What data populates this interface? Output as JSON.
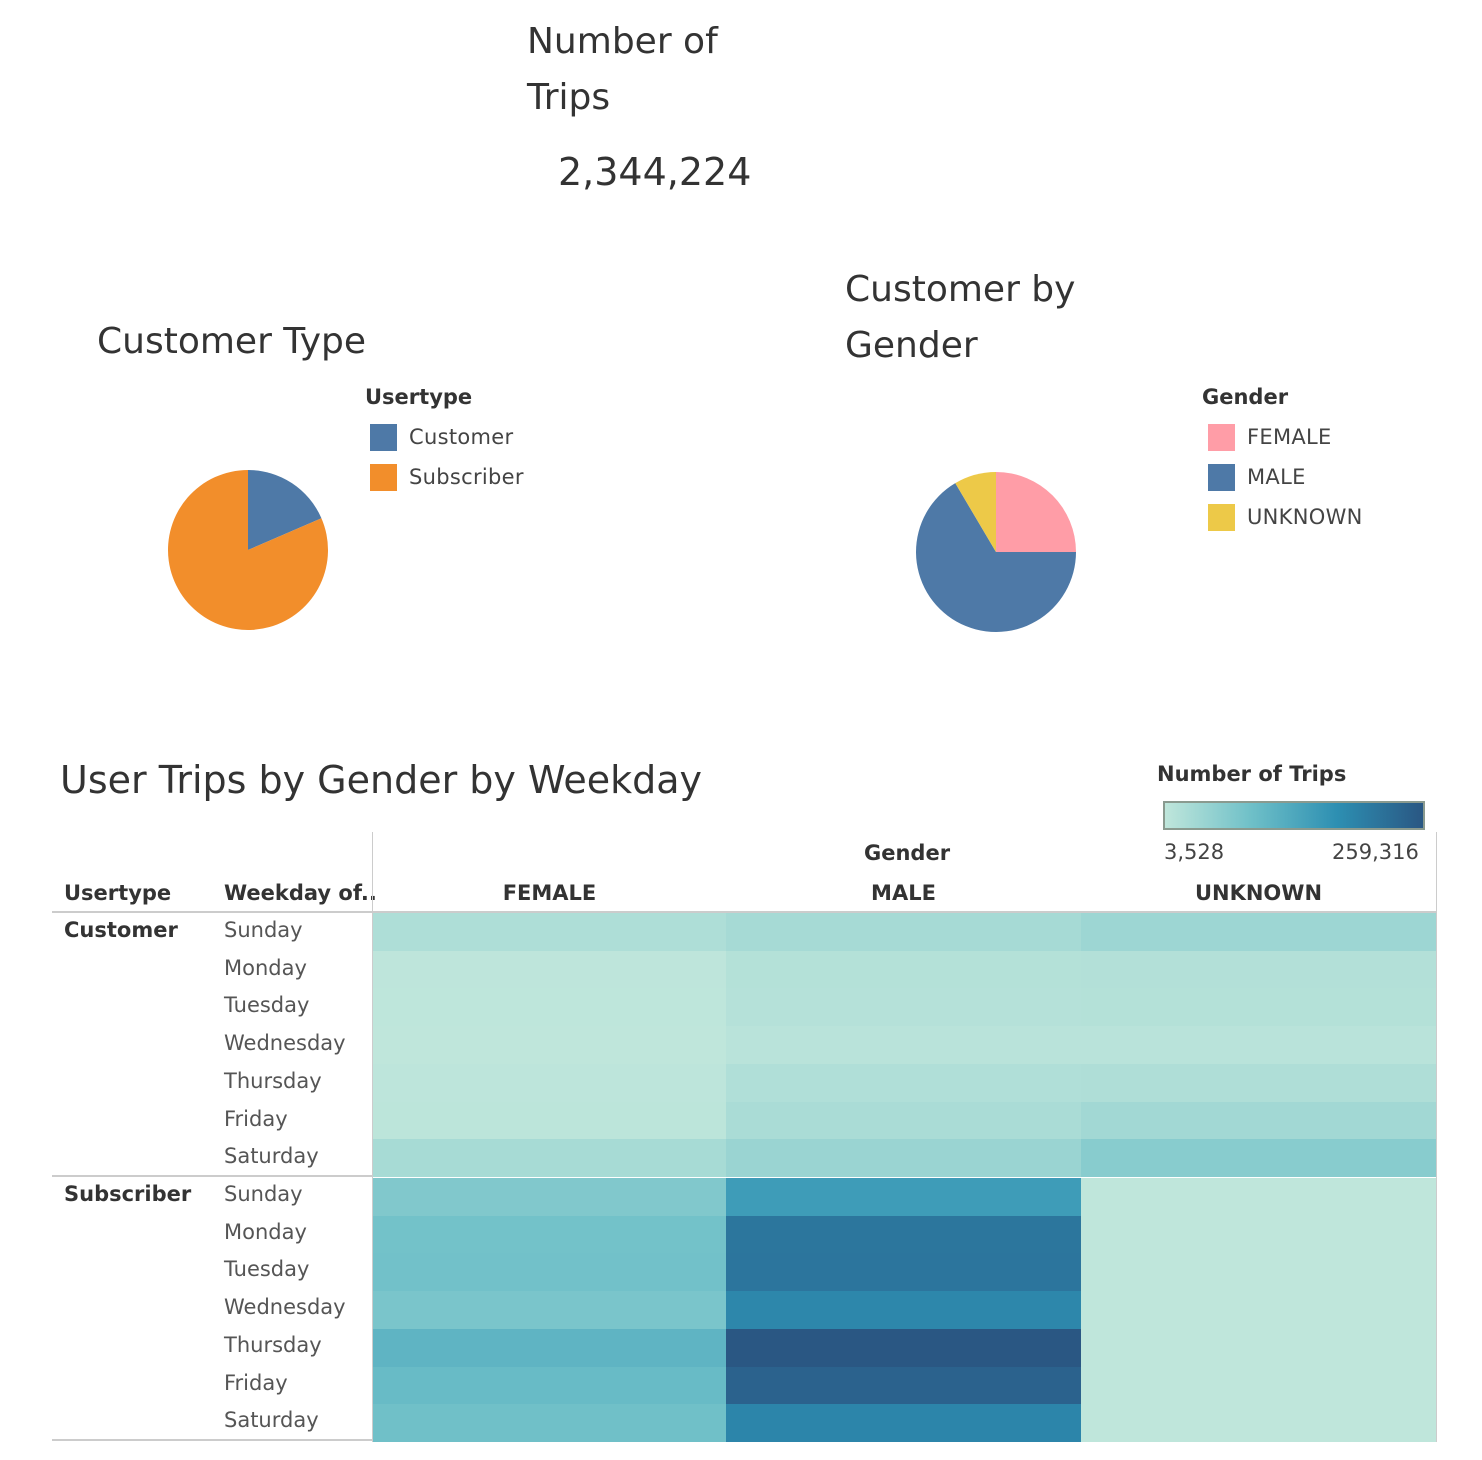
{
  "kpi": {
    "title": "Number of Trips",
    "value": "2,344,224"
  },
  "customer_type": {
    "title": "Customer Type",
    "legend_title": "Usertype",
    "items": [
      {
        "label": "Customer",
        "color": "#4e79a7"
      },
      {
        "label": "Subscriber",
        "color": "#f28e2b"
      }
    ]
  },
  "customer_gender": {
    "title": "Customer by Gender",
    "legend_title": "Gender",
    "items": [
      {
        "label": "FEMALE",
        "color": "#ff9da7"
      },
      {
        "label": "MALE",
        "color": "#4e79a7"
      },
      {
        "label": "UNKNOWN",
        "color": "#edc948"
      }
    ]
  },
  "heatmap": {
    "title": "User Trips by Gender by Weekday",
    "legend_title": "Number of Trips",
    "legend_min": "3,528",
    "legend_max": "259,316",
    "col_group_header": "Gender",
    "row_header_1": "Usertype",
    "row_header_2": "Weekday of..",
    "columns": [
      "FEMALE",
      "MALE",
      "UNKNOWN"
    ],
    "groups": [
      {
        "label": "Customer"
      },
      {
        "label": "Subscriber"
      }
    ],
    "weekdays": [
      "Sunday",
      "Monday",
      "Tuesday",
      "Wednesday",
      "Thursday",
      "Friday",
      "Saturday"
    ]
  },
  "chart_data": [
    {
      "type": "pie",
      "title": "Customer Type",
      "labels": [
        "Customer",
        "Subscriber"
      ],
      "values": [
        18.5,
        81.5
      ],
      "colors": [
        "#4e79a7",
        "#f28e2b"
      ]
    },
    {
      "type": "pie",
      "title": "Customer by Gender",
      "labels": [
        "FEMALE",
        "MALE",
        "UNKNOWN"
      ],
      "values": [
        25,
        66.5,
        8.5
      ],
      "colors": [
        "#ff9da7",
        "#4e79a7",
        "#edc948"
      ]
    },
    {
      "type": "heatmap",
      "title": "User Trips by Gender by Weekday",
      "columns": [
        "FEMALE",
        "MALE",
        "UNKNOWN"
      ],
      "rows": [
        "Customer|Sunday",
        "Customer|Monday",
        "Customer|Tuesday",
        "Customer|Wednesday",
        "Customer|Thursday",
        "Customer|Friday",
        "Customer|Saturday",
        "Subscriber|Sunday",
        "Subscriber|Monday",
        "Subscriber|Tuesday",
        "Subscriber|Wednesday",
        "Subscriber|Thursday",
        "Subscriber|Friday",
        "Subscriber|Saturday"
      ],
      "values": [
        [
          22000,
          30000,
          40000
        ],
        [
          5000,
          15000,
          16000
        ],
        [
          4500,
          14000,
          15000
        ],
        [
          4000,
          9500,
          10000
        ],
        [
          5500,
          19000,
          21000
        ],
        [
          6500,
          26000,
          34000
        ],
        [
          29000,
          43000,
          62000
        ],
        [
          70000,
          152000,
          3600
        ],
        [
          85000,
          212000,
          3600
        ],
        [
          86000,
          213000,
          3600
        ],
        [
          77000,
          186000,
          3600
        ],
        [
          109000,
          259316,
          3600
        ],
        [
          98000,
          242000,
          3600
        ],
        [
          88000,
          189000,
          3528
        ]
      ],
      "range": [
        3528,
        259316
      ],
      "color_scale": [
        "#bfe6db",
        "#2a5783"
      ]
    }
  ]
}
